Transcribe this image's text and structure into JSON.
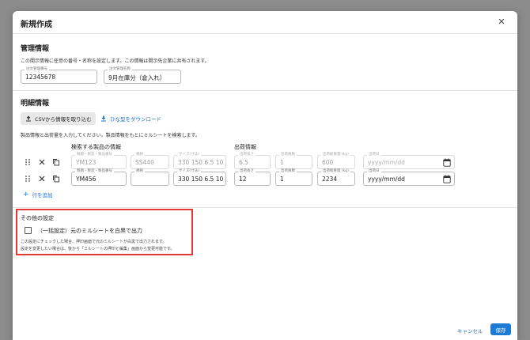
{
  "dialog": {
    "title": "新規作成",
    "close_icon": "close-icon"
  },
  "management": {
    "title": "管理情報",
    "description": "この開示情報に任意の番号・名称を設定します。この情報は開示先企業に共有されます。",
    "order_number": {
      "label": "注文管理番号",
      "value": "12345678"
    },
    "order_name": {
      "label": "注文管理名称",
      "value": "9月在庫分（倉入れ）"
    }
  },
  "details": {
    "title": "明細情報",
    "csv_button": "CSVから情報を取り込む",
    "template_link": "ひな型をダウンロード",
    "description": "製品情報と出荷量を入力してください。製品情報をもとにミルシートを検索します。",
    "search_header": "検索する製品の情報",
    "shipping_header": "出荷情報",
    "rows": [
      {
        "product_no": {
          "label": "製鋼・製造・製品番号",
          "value": "YM123"
        },
        "spec": {
          "label": "規格",
          "value": "SS440"
        },
        "size": {
          "label": "サイズ(寸法)",
          "value": "330 150 6.5 10"
        },
        "length": {
          "label": "出荷長さ",
          "value": "6.5"
        },
        "count": {
          "label": "出荷員数",
          "value": "1"
        },
        "weight": {
          "label": "出荷総重量 (kg)",
          "value": "600"
        },
        "date": {
          "label": "出荷日",
          "value": "yyyy/mm/dd"
        }
      },
      {
        "product_no": {
          "label": "製鋼・製造・製品番号",
          "value": "YM456"
        },
        "spec": {
          "label": "規格",
          "value": ""
        },
        "size": {
          "label": "サイズ(寸法)",
          "value": "330 150 6.5 10"
        },
        "length": {
          "label": "出荷長さ",
          "value": "12"
        },
        "count": {
          "label": "出荷員数",
          "value": "1"
        },
        "weight": {
          "label": "出荷総重量 (kg)",
          "value": "2234"
        },
        "date": {
          "label": "出荷日",
          "value": "yyyy/mm/dd"
        }
      }
    ],
    "add_row": "行を追加"
  },
  "other": {
    "title": "その他の設定",
    "checkbox_label": "（一括設定）元のミルシートを白黒で出力",
    "note_line1": "この設定にチェックした場合、押印画面で元のミルシートが白黒で出力されます。",
    "note_line2": "設定を変更したい場合は、後から「ミルシートの押印と編集」画面から変更可能です。",
    "checked": false
  },
  "footer": {
    "cancel": "キャンセル",
    "save": "保存"
  },
  "colors": {
    "accent": "#1d7bd6",
    "highlight_box": "#e53935"
  }
}
